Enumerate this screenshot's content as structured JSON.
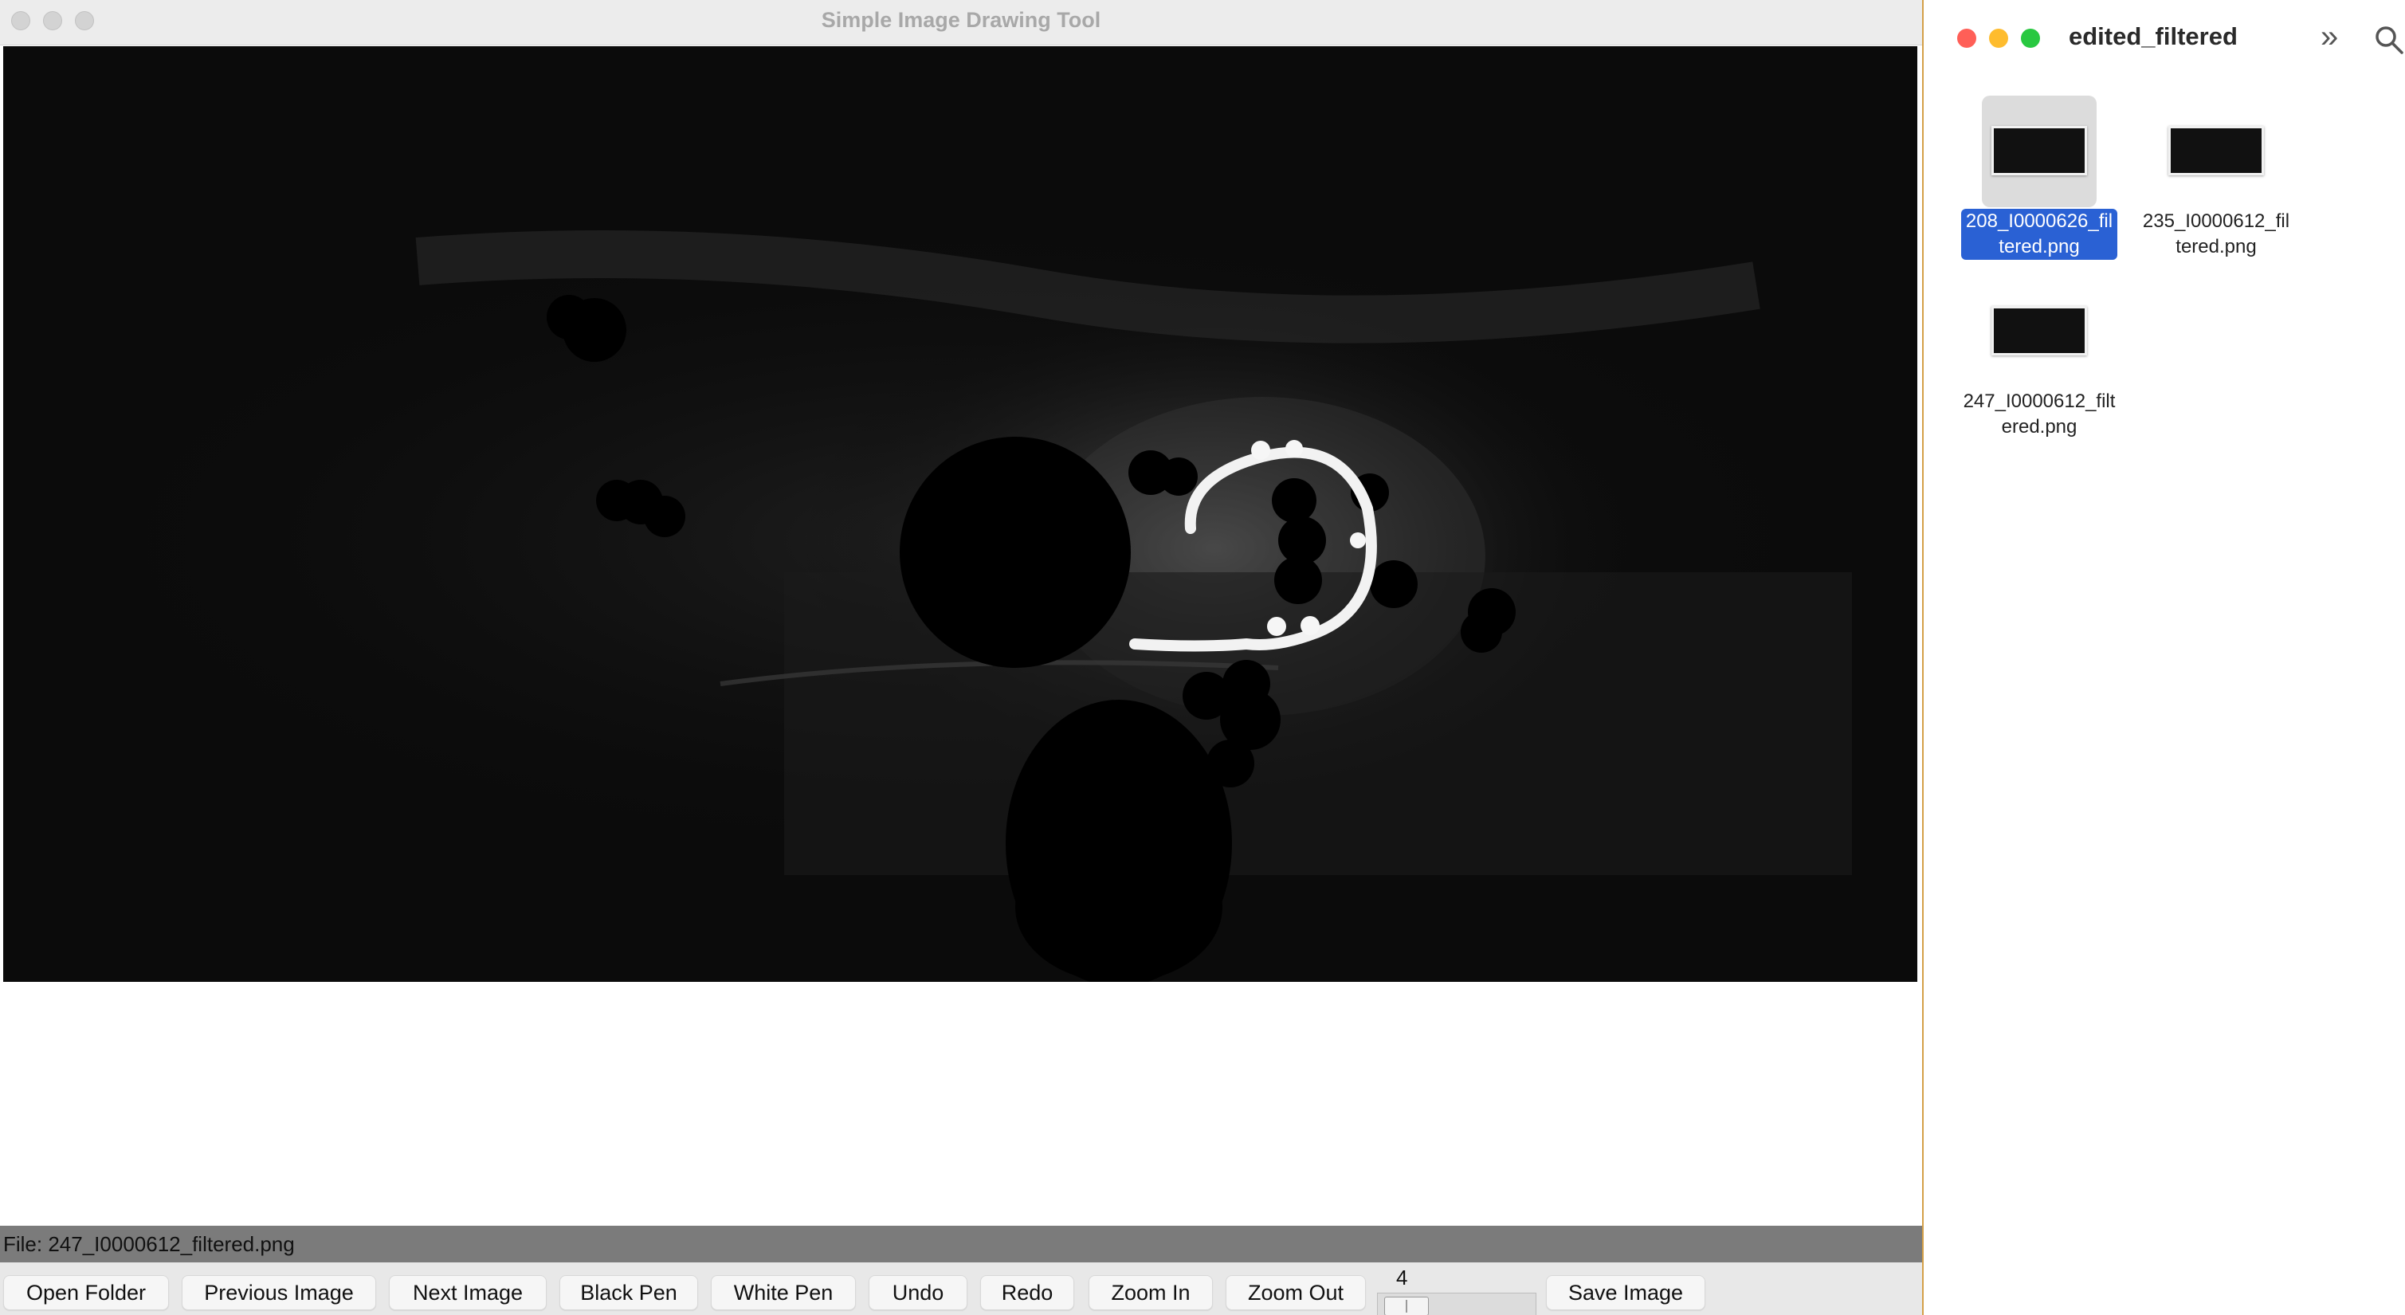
{
  "app": {
    "title": "Simple Image Drawing Tool",
    "status": "File: 247_I0000612_filtered.png",
    "toolbar": {
      "open_folder": "Open Folder",
      "previous_image": "Previous Image",
      "next_image": "Next Image",
      "black_pen": "Black Pen",
      "white_pen": "White Pen",
      "undo": "Undo",
      "redo": "Redo",
      "zoom_in": "Zoom In",
      "zoom_out": "Zoom Out",
      "pen_size": "4",
      "save_image": "Save Image"
    }
  },
  "finder": {
    "title": "edited_filtered",
    "files": [
      {
        "name": "208_I0000626_filtered.png",
        "label_line1": "208_I0000626_fil",
        "label_line2": "tered.png",
        "selected": true
      },
      {
        "name": "235_I0000612_filtered.png",
        "label_line1": "235_I0000612_fil",
        "label_line2": "tered.png",
        "selected": false
      },
      {
        "name": "247_I0000612_filtered.png",
        "label_line1": "247_I0000612_filt",
        "label_line2": "ered.png",
        "selected": false
      }
    ]
  },
  "colors": {
    "selection": "#2a61d4",
    "canvas_background": "#0b0b0b",
    "status_bar": "#7b7b7b",
    "close": "#ff5f57",
    "minimize": "#febc2e",
    "zoom": "#28c840"
  },
  "icons": [
    "chevron-double-right-icon",
    "search-icon"
  ]
}
